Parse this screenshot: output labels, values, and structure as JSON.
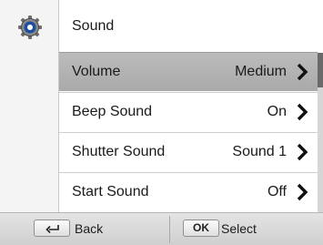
{
  "menu": {
    "title": "Sound",
    "icon": "settings-gear-icon",
    "items": [
      {
        "label": "Volume",
        "value": "Medium",
        "selected": true
      },
      {
        "label": "Beep Sound",
        "value": "On",
        "selected": false
      },
      {
        "label": "Shutter Sound",
        "value": "Sound 1",
        "selected": false
      },
      {
        "label": "Start Sound",
        "value": "Off",
        "selected": false
      }
    ]
  },
  "footer": {
    "back_label": "Back",
    "ok_key": "OK",
    "select_label": "Select"
  },
  "colors": {
    "selected_row": "#b3b3b3",
    "gear_blue": "#1c4fa3"
  }
}
